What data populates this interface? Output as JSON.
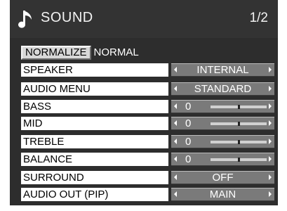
{
  "header": {
    "title": "SOUND",
    "page": "1/2",
    "icon": "music-note-icon"
  },
  "normalize": {
    "button_label": "NORMALIZE",
    "status": "NORMAL"
  },
  "items": [
    {
      "label": "SPEAKER",
      "value": "INTERNAL",
      "kind": "select"
    },
    {
      "label": "AUDIO MENU",
      "value": "STANDARD",
      "kind": "select"
    },
    {
      "label": "BASS",
      "value": "0",
      "kind": "slider",
      "level": 0.5
    },
    {
      "label": "MID",
      "value": "0",
      "kind": "slider",
      "level": 0.5
    },
    {
      "label": "TREBLE",
      "value": "0",
      "kind": "slider",
      "level": 0.5
    },
    {
      "label": "BALANCE",
      "value": "0",
      "kind": "slider",
      "level": 0.5
    },
    {
      "label": "SURROUND",
      "value": "OFF",
      "kind": "select"
    },
    {
      "label": "AUDIO OUT (PIP)",
      "value": "MAIN",
      "kind": "select"
    }
  ],
  "colors": {
    "panel": "#2d2d2d",
    "label_bg": "#ffffff",
    "control_bg": "#7a7a7a"
  }
}
